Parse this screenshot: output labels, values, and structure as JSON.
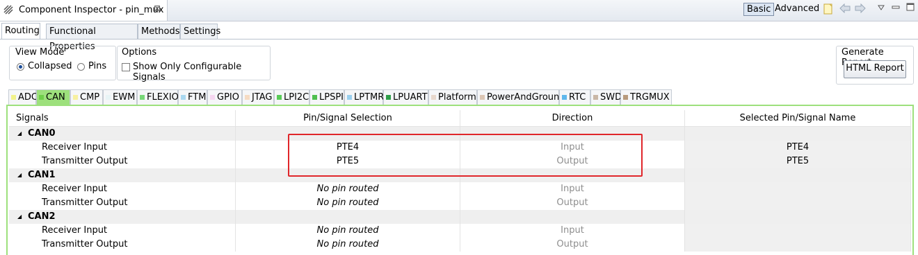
{
  "window": {
    "title": "Component Inspector - pin_mux",
    "close_glyph": "⊠",
    "mode_basic": "Basic",
    "mode_advanced": "Advanced",
    "toolbar_icons": [
      "report-icon",
      "back-arrow-icon",
      "forward-arrow-icon",
      "view-menu-icon",
      "minimize-icon",
      "maximize-icon"
    ]
  },
  "tabs": [
    "Routing",
    "Functional Properties",
    "Methods",
    "Settings"
  ],
  "view_mode": {
    "label": "View Mode",
    "options": [
      "Collapsed",
      "Pins"
    ],
    "selected": "Collapsed"
  },
  "options": {
    "label": "Options",
    "checkbox_label": "Show Only Configurable Signals",
    "checked": false
  },
  "report": {
    "label": "Generate Report",
    "button": "HTML Report"
  },
  "peripheral_tabs": [
    {
      "label": "ADC",
      "color": "#f2f28a"
    },
    {
      "label": "CAN",
      "color": "#6fcf4a"
    },
    {
      "label": "CMP",
      "color": "#f7f0a0"
    },
    {
      "label": "EWM",
      "color": "#e8f4f6"
    },
    {
      "label": "FLEXIO",
      "color": "#78d878"
    },
    {
      "label": "FTM",
      "color": "#a9d8f0"
    },
    {
      "label": "GPIO",
      "color": "#f5d6f0"
    },
    {
      "label": "JTAG",
      "color": "#f6dbc3"
    },
    {
      "label": "LPI2C",
      "color": "#58cc58"
    },
    {
      "label": "LPSPI",
      "color": "#4fbf4f"
    },
    {
      "label": "LPTMR",
      "color": "#9ad0ef"
    },
    {
      "label": "LPUART",
      "color": "#2e9e4a"
    },
    {
      "label": "Platform",
      "color": "#e8d8cc"
    },
    {
      "label": "PowerAndGround",
      "color": "#dcc6b4"
    },
    {
      "label": "RTC",
      "color": "#5fb8ec"
    },
    {
      "label": "SWD",
      "color": "#c9b7a6"
    },
    {
      "label": "TRGMUX",
      "color": "#b89a7c"
    }
  ],
  "active_peripheral": "CAN",
  "table": {
    "columns": [
      "Signals",
      "Pin/Signal Selection",
      "Direction",
      "Selected Pin/Signal Name"
    ],
    "groups": [
      {
        "name": "CAN0",
        "rows": [
          {
            "signal": "Receiver Input",
            "pin": "PTE4",
            "direction": "Input",
            "selected": "PTE4"
          },
          {
            "signal": "Transmitter Output",
            "pin": "PTE5",
            "direction": "Output",
            "selected": "PTE5"
          }
        ]
      },
      {
        "name": "CAN1",
        "rows": [
          {
            "signal": "Receiver Input",
            "pin": "No pin routed",
            "direction": "Input",
            "selected": ""
          },
          {
            "signal": "Transmitter Output",
            "pin": "No pin routed",
            "direction": "Output",
            "selected": ""
          }
        ]
      },
      {
        "name": "CAN2",
        "rows": [
          {
            "signal": "Receiver Input",
            "pin": "No pin routed",
            "direction": "Input",
            "selected": ""
          },
          {
            "signal": "Transmitter Output",
            "pin": "No pin routed",
            "direction": "Output",
            "selected": ""
          }
        ]
      }
    ]
  },
  "expand_glyph": "◢"
}
